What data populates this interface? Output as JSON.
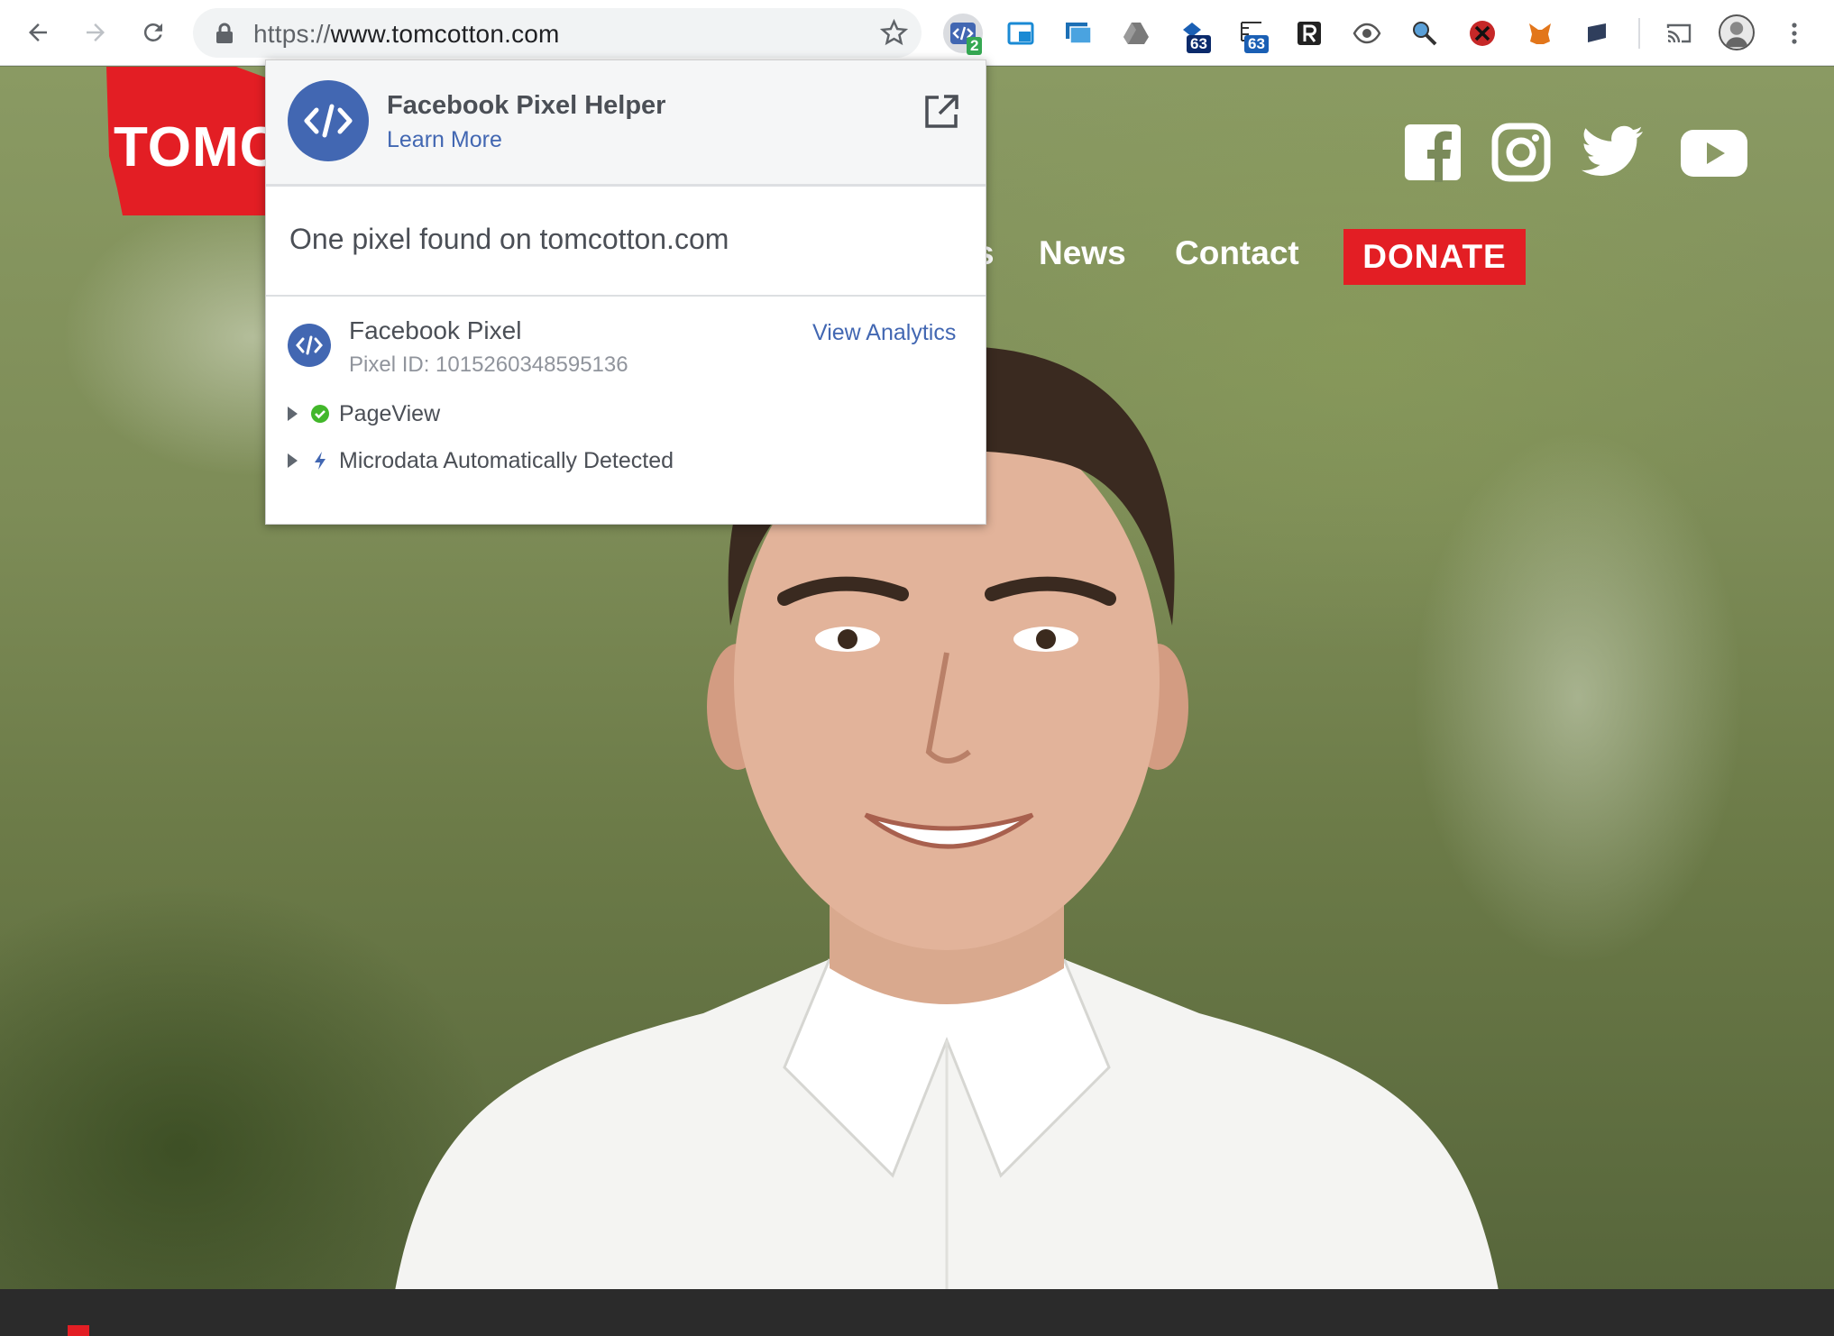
{
  "browser": {
    "url_protocol": "https://",
    "url_host": "www.tomcotton.com",
    "pixel_helper_badge": "2",
    "ext_badge_1": "63",
    "ext_badge_2": "63"
  },
  "site": {
    "logo_text": "TOMC",
    "nav_partial": "s",
    "nav": [
      "News",
      "Contact"
    ],
    "donate_label": "DONATE",
    "brand_color": "#e31e24"
  },
  "popup": {
    "title": "Facebook Pixel Helper",
    "learn_more": "Learn More",
    "summary": "One pixel found on tomcotton.com",
    "pixel_name": "Facebook Pixel",
    "pixel_id": "Pixel ID: 1015260348595136",
    "view_analytics": "View Analytics",
    "events": [
      {
        "label": "PageView",
        "icon": "check-circle-icon"
      },
      {
        "label": "Microdata Automatically Detected",
        "icon": "lightning-icon"
      }
    ],
    "accent_color": "#4267b2"
  }
}
